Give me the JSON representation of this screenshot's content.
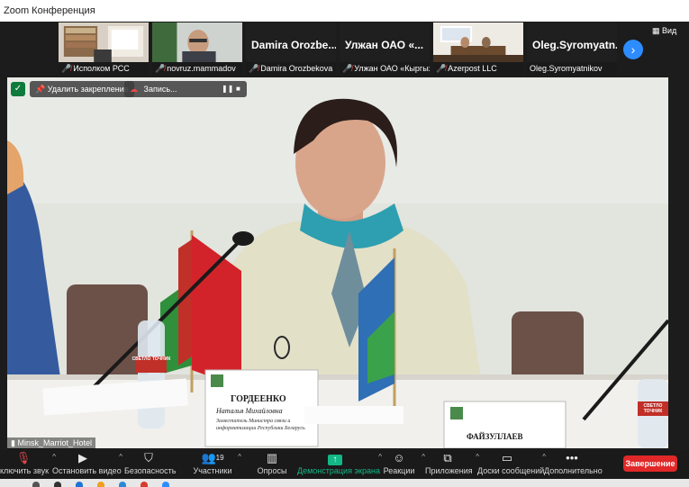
{
  "window": {
    "title": "Zoom Конференция"
  },
  "thumbnails": [
    {
      "name": "Исполком РСС",
      "muted": true
    },
    {
      "name": "novruz.mammadov",
      "muted": true
    },
    {
      "name": "Damira Orozbekova",
      "muted": true,
      "big_label": "Damira  Orozbe..."
    },
    {
      "name": "Улжан ОАО «Кыргыз...",
      "muted": true,
      "big_label": "Улжан  ОАО  «..."
    },
    {
      "name": "Azerpost LLC",
      "muted": true
    },
    {
      "name": "Oleg.Syromyatnikov",
      "muted": false,
      "big_label": "Oleg.Syromyatn..."
    }
  ],
  "view_button": {
    "label": "Вид",
    "icon": "grid-icon"
  },
  "next_page_icon": "chevron-right-icon",
  "overlay": {
    "unpin_label": "Удалить закрепление",
    "recording_label": "Запись...",
    "pause_icon": "pause-icon",
    "stop_icon": "stop-icon"
  },
  "speaker": {
    "label": "Minsk_Marriot_Hotel",
    "nameplate_name": "ГОРДЕЕНКО",
    "nameplate_patronymic": "Наталья Михайловна",
    "nameplate_title": "Заместитель Министра связи и информатизации Республики Беларусь",
    "second_nameplate": "ФАЙЗУЛЛАЕВ",
    "bottle_left": "СВЕТЛО ТОЧНИК",
    "bottle_right": "СВЕТЛО ТОЧНИК"
  },
  "toolbar": {
    "mute_label": "ключить звук",
    "video_label": "Остановить видео",
    "security_label": "Безопасность",
    "participants_label": "Участники",
    "participants_count": "19",
    "polls_label": "Опросы",
    "share_label": "Демонстрация экрана",
    "reactions_label": "Реакции",
    "apps_label": "Приложения",
    "whiteboard_label": "Доски сообщений",
    "more_label": "Дополнительно",
    "end_label": "Завершение"
  },
  "colors": {
    "accent_blue": "#2d8cff",
    "share_green": "#12b886",
    "end_red": "#e02828",
    "muted_red": "#e5484d"
  }
}
